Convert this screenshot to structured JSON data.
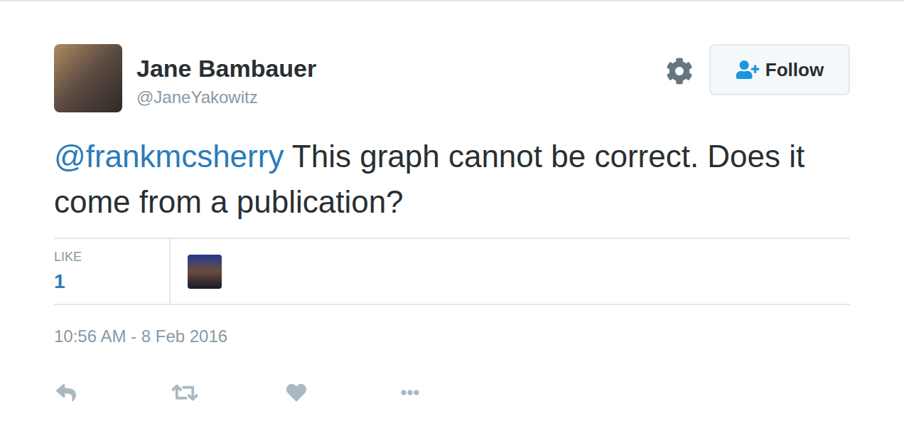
{
  "user": {
    "name": "Jane Bambauer",
    "handle": "@JaneYakowitz"
  },
  "follow_button": {
    "label": "Follow"
  },
  "tweet": {
    "mention": "@frankmcsherry",
    "text": " This graph cannot be correct. Does it come from a publication?"
  },
  "stats": {
    "label": "LIKE",
    "count": "1"
  },
  "likers": [
    {
      "photo": true
    }
  ],
  "timestamp": "10:56 AM - 8 Feb 2016",
  "actions": {
    "liked": false,
    "retweeted": false
  }
}
